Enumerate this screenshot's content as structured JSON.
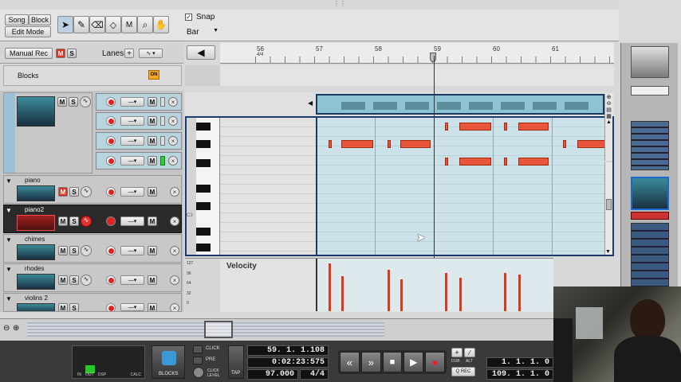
{
  "toolbar": {
    "song_label": "Song",
    "block_label": "Block",
    "edit_mode_label": "Edit Mode",
    "snap_label": "Snap",
    "snap_checked": true,
    "snap_value": "Bar"
  },
  "left_header": {
    "manual_rec_label": "Manual Rec",
    "m_label": "M",
    "s_label": "S",
    "lanes_label": "Lanes",
    "lanes_add": "+",
    "blocks_label": "Blocks",
    "blocks_on_label": "ON"
  },
  "ruler": {
    "bars": [
      "56",
      "57",
      "58",
      "59",
      "60",
      "61"
    ],
    "time_sig": "4/4"
  },
  "tracks": [
    {
      "name": "",
      "selected": false
    },
    {
      "name": "piano",
      "selected": false
    },
    {
      "name": "piano2",
      "selected": true
    },
    {
      "name": "chimes",
      "selected": false
    },
    {
      "name": "rhodes",
      "selected": false
    },
    {
      "name": "violins 2",
      "selected": false
    }
  ],
  "lane_buttons": {
    "m": "M",
    "s": "S",
    "close": "×"
  },
  "piano_roll": {
    "c3_label": "C3",
    "velocity_label": "Velocity",
    "velocity_ticks": [
      "127",
      "96",
      "64",
      "32",
      "0"
    ]
  },
  "transport": {
    "click_label": "CLICK",
    "pre_label": "PRE",
    "click_level_label": "CLICK LEVEL",
    "tap_label": "TAP",
    "blocks_label": "BLOCKS",
    "in_label": "IN",
    "out_label": "OUT",
    "dsp_label": "DSP",
    "calc_label": "CALC",
    "position": "59. 1. 1.108",
    "time": "0:02:23:575",
    "tempo": "97.000",
    "signature": "4/4",
    "loop_left": "1. 1. 1.   0",
    "loop_right": "109. 1. 1.   0",
    "dub_label": "DUB",
    "alt_label": "ALT",
    "qrec_label": "Q REC"
  },
  "colors": {
    "note": "#e8553a",
    "lane_bg": "#c8dfe6",
    "selected_track": "#2a2a2a",
    "accent_blue": "#1a4aa0"
  }
}
